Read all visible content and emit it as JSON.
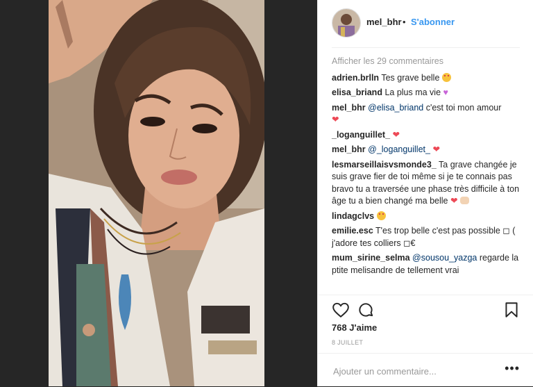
{
  "post": {
    "username": "mel_bhr",
    "separator": "•",
    "follow_label": "S'abonner"
  },
  "comments": {
    "load_more": "Afficher les 29 commentaires",
    "items": [
      {
        "user": "adrien.brlln",
        "text": "Tes grave belle"
      },
      {
        "user": "elisa_briand",
        "text": "La plus ma vie"
      },
      {
        "user": "mel_bhr",
        "mention": "@elisa_briand",
        "text": "c'est toi mon amour"
      },
      {
        "user": "_loganguillet_",
        "text": ""
      },
      {
        "user": "mel_bhr",
        "mention": "@_loganguillet_",
        "text": ""
      },
      {
        "user": "lesmarseillaisvsmonde3_",
        "text": "Ta grave changée je suis grave fier de toi même si je te connais pas bravo tu a traversée une phase très difficile à ton âge tu a bien changé ma belle"
      },
      {
        "user": "lindagclvs",
        "text": ""
      },
      {
        "user": "emilie.esc",
        "text": "T'es trop belle c'est pas possible ◻ ( j'adore tes colliers ◻€"
      },
      {
        "user": "mum_sirine_selma",
        "mention": "@sousou_yazga",
        "text": "regarde la ptite melisandre de tellement vrai"
      }
    ]
  },
  "likes": "768 J'aime",
  "date": "8 JUILLET",
  "add_comment": {
    "placeholder": "Ajouter un commentaire..."
  },
  "more_label": "•••",
  "colors": {
    "link_blue": "#3897f0",
    "mention_navy": "#003569",
    "heart_red": "#ed4956",
    "muted_gray": "#999999"
  },
  "icons": [
    "heart-icon",
    "comment-icon",
    "bookmark-icon"
  ]
}
